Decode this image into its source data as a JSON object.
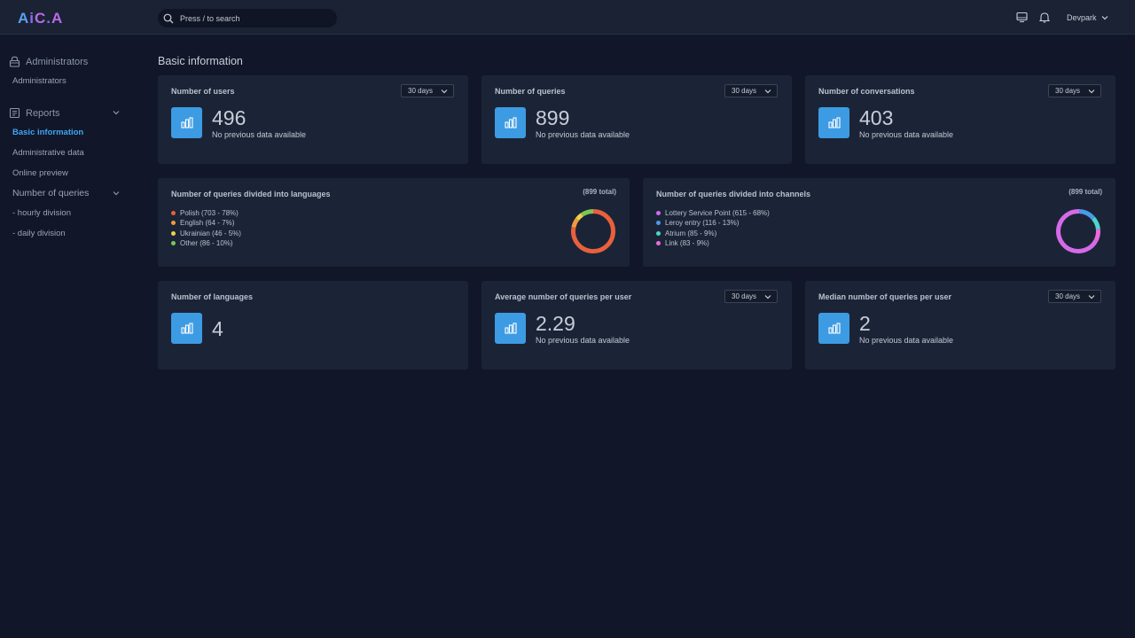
{
  "app": {
    "logo": "AiCA",
    "search_placeholder": "Press / to search",
    "user_name": "Devpark"
  },
  "sidebar": {
    "administrators_section": "Administrators",
    "administrators_item": "Administrators",
    "reports_section": "Reports",
    "items": [
      "Basic information",
      "Administrative data",
      "Online preview"
    ],
    "queries_section": "Number of queries",
    "query_items": [
      "- hourly division",
      "- daily division"
    ]
  },
  "main": {
    "title": "Basic information",
    "stats_top": [
      {
        "title": "Number of users",
        "period": "30 days",
        "value": "496",
        "note": "No previous data available"
      },
      {
        "title": "Number of queries",
        "period": "30 days",
        "value": "899",
        "note": "No previous data available"
      },
      {
        "title": "Number of conversations",
        "period": "30 days",
        "value": "403",
        "note": "No previous data available"
      }
    ],
    "stats_bottom": [
      {
        "title": "Number of languages",
        "value": "4"
      },
      {
        "title": "Average number of queries per user",
        "period": "30 days",
        "value": "2.29",
        "note": "No previous data available"
      },
      {
        "title": "Median number of queries per user",
        "period": "30 days",
        "value": "2",
        "note": "No previous data available"
      }
    ]
  },
  "chart_data": [
    {
      "type": "pie",
      "title": "Number of queries divided into languages",
      "total_label": "(899 total)",
      "categories": [
        "Polish (703 - 78%)",
        "English (64 - 7%)",
        "Ukrainian (46 - 5%)",
        "Other (86 - 10%)"
      ],
      "values": [
        703,
        64,
        46,
        86
      ],
      "colors": [
        "#e8603c",
        "#f09a3e",
        "#f0d04a",
        "#7fc455"
      ]
    },
    {
      "type": "pie",
      "title": "Number of queries divided into channels",
      "total_label": "(899 total)",
      "categories": [
        "Lottery Service Point (615 - 68%)",
        "Leroy entry (116 - 13%)",
        "Atrium (85 - 9%)",
        "Link (83 - 9%)"
      ],
      "values": [
        615,
        116,
        85,
        83
      ],
      "colors": [
        "#d56ae8",
        "#4a9ae8",
        "#4ad6c8",
        "#e86ae0"
      ]
    }
  ],
  "colors": {
    "accent": "#3ea6f0",
    "stat_icon_bg": "#3d9be4",
    "card_bg": "#1b2436",
    "page_bg": "#111729"
  }
}
